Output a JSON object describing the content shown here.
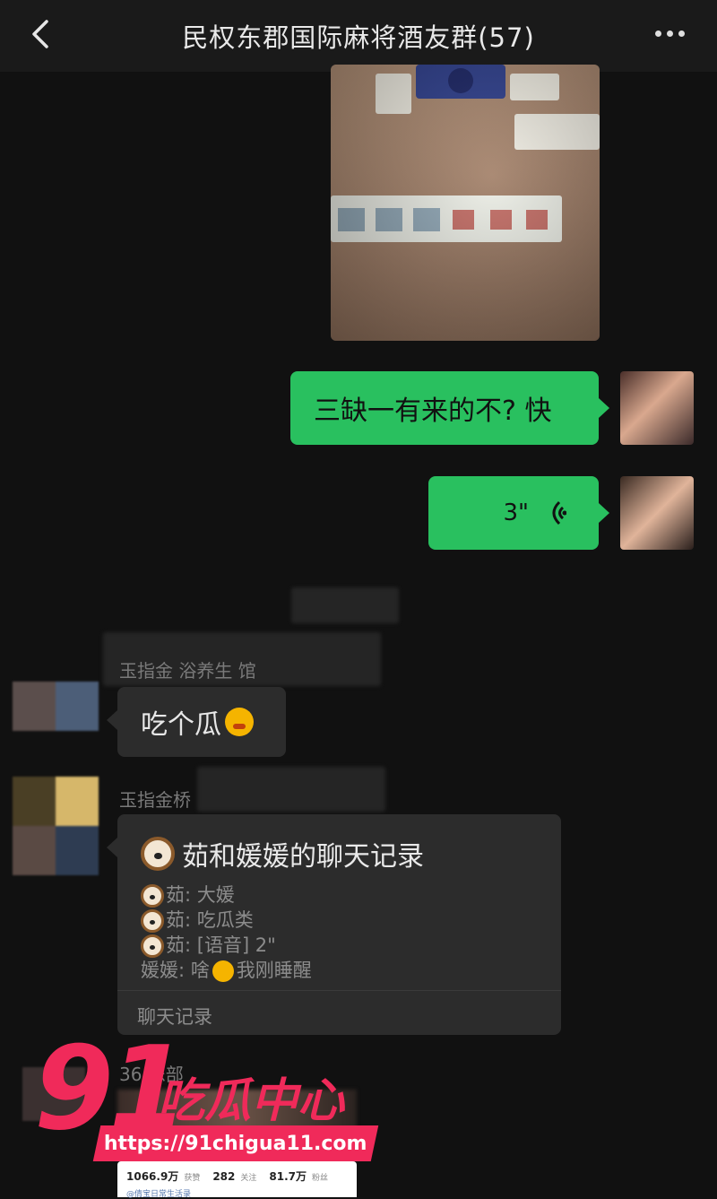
{
  "header": {
    "title": "民权东郡国际麻将酒友群(57)"
  },
  "messages": {
    "me_text": "三缺一有来的不? 快",
    "me_voice_duration": "3\"",
    "sender1": "玉指金   浴养生   馆",
    "other_text": "吃个瓜",
    "sender2": "玉指金桥",
    "history": {
      "title": "茹和媛媛的聊天记录",
      "line1": "茹: 大媛",
      "line2": "茹: 吃瓜类",
      "line3": "茹: [语音] 2\"",
      "line4a": "媛媛: 啥",
      "line4b": "我刚睡醒",
      "footer": "聊天记录"
    },
    "sender3": "36  乐部"
  },
  "bottom_card": {
    "likes": "1066.9万",
    "likes_label": "获赞",
    "follow": "282",
    "follow_label": "关注",
    "fans": "81.7万",
    "fans_label": "粉丝",
    "handle": "@倩宝日常生活录"
  },
  "watermark": {
    "num": "91",
    "text": "吃瓜中心",
    "url": "https://91chigua11.com"
  }
}
